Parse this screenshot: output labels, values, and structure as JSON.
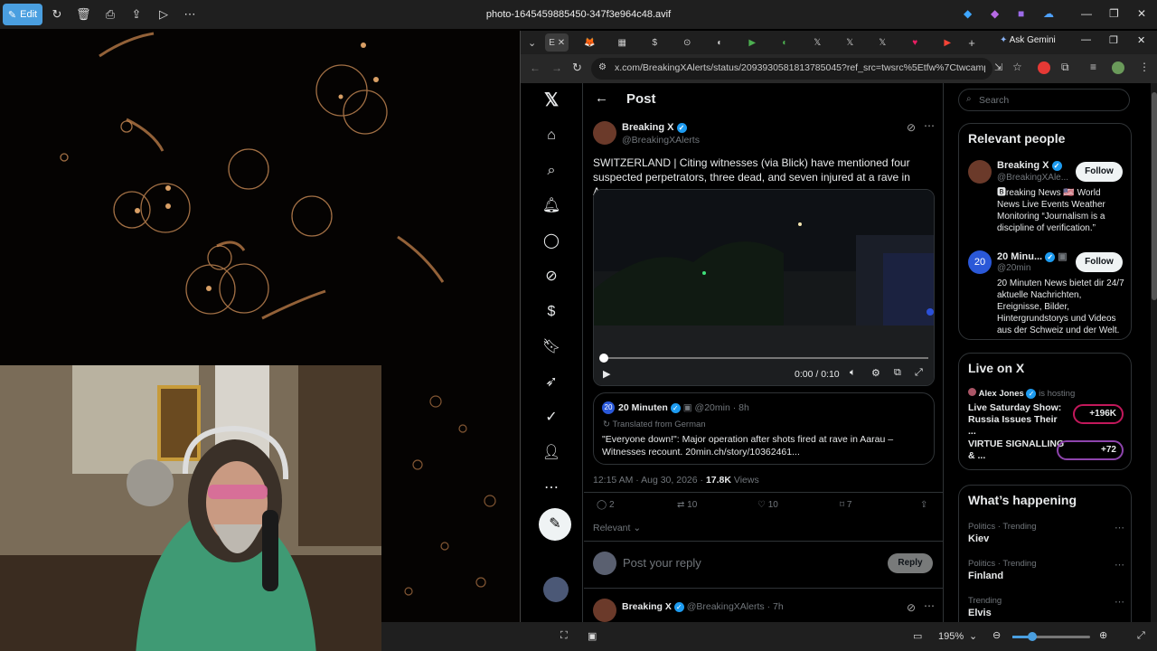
{
  "viewer": {
    "edit_label": "Edit",
    "file_name": "photo-1645459885450-347f3e964c48.avif",
    "zoom": "195%"
  },
  "browser": {
    "url": "x.com/BreakingXAlerts/status/2093930581813785045?ref_src=twsrc%5Etfw%7Ctwcamp%5Etwee...",
    "ask_gemini": "Ask Gemini"
  },
  "post": {
    "header_title": "Post",
    "author_name": "Breaking X",
    "author_handle": "@BreakingXAlerts",
    "text": "SWITZERLAND |  Citing witnesses (via Blick) have mentioned four suspected perpetrators, three dead, and seven injured at a rave in Aarau.",
    "video_time": "0:00 / 0:10",
    "quote": {
      "name": "20 Minuten",
      "handle": "@20min",
      "age": "· 8h",
      "translated": "Translated from German",
      "text": "\"Everyone down!\": Major operation after shots fired at rave in Aarau – Witnesses recount. 20min.ch/story/10362461..."
    },
    "timestamp": "12:15 AM · Aug 30, 2026 ·",
    "views_count": "17.8K",
    "views_label": "Views",
    "replies": "2",
    "reposts": "10",
    "likes": "10",
    "bookmarks": "7",
    "relevant": "Relevant",
    "reply_placeholder": "Post your reply",
    "reply_button": "Reply",
    "next_author": "Breaking X",
    "next_handle": "@BreakingXAlerts",
    "next_age": "· 7h"
  },
  "sidebar": {
    "search_placeholder": "Search",
    "relevant_title": "Relevant people",
    "people": [
      {
        "name": "Breaking X",
        "handle": "@BreakingXAle...",
        "bio": "🅱reaking News 🇺🇸 World News Live Events Weather Monitoring “Journalism is a discipline of verification.”",
        "follow": "Follow"
      },
      {
        "name": "20 Minu...",
        "handle": "@20min",
        "bio": "20 Minuten News bietet dir 24/7 aktuelle Nachrichten, Ereignisse, Bilder, Hintergrundstorys und Videos aus der Schweiz und der Welt.",
        "follow": "Follow"
      }
    ],
    "live_title": "Live on X",
    "live": [
      {
        "host": "Alex Jones",
        "hosting": "is hosting",
        "title": "Live Saturday Show: Russia Issues Their ...",
        "count": "+196K"
      },
      {
        "title": "VIRTUE SIGNALLING & ...",
        "count": "+72"
      }
    ],
    "happening_title": "What’s happening",
    "trends": [
      {
        "context": "Politics · Trending",
        "name": "Kiev"
      },
      {
        "context": "Politics · Trending",
        "name": "Finland"
      },
      {
        "context": "Trending",
        "name": "Elvis"
      }
    ]
  },
  "colors": {
    "accent": "#1d9bf0",
    "edit": "#4a9fe0",
    "live": "#c2185b"
  }
}
